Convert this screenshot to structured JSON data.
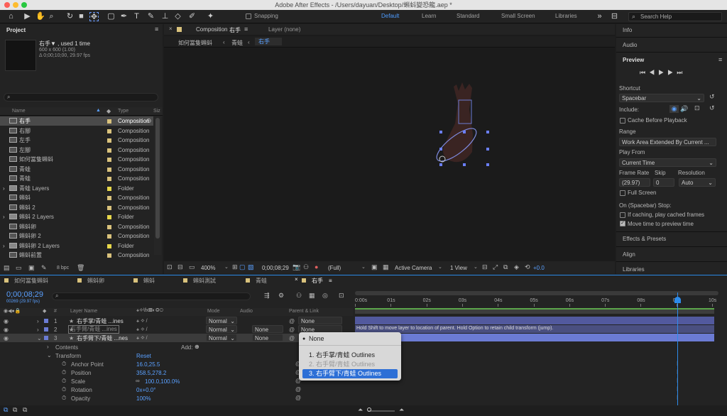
{
  "titlebar": {
    "title": "Adobe After Effects - /Users/dayuan/Desktop/蝌蚪變恐龍.aep *"
  },
  "toolbar": {
    "snapping": "Snapping",
    "workspaces": [
      "Default",
      "Learn",
      "Standard",
      "Small Screen",
      "Libraries"
    ],
    "search": "Search Help"
  },
  "project": {
    "tab": "Project",
    "item_name": "右手▼ , used 1 time",
    "item_size": "600 x 600 (1.00)",
    "item_dur": "Δ 0;00;10;00, 29.97 fps",
    "col_name": "Name",
    "col_type": "Type",
    "col_size": "Siz",
    "bpc": "8 bpc",
    "items": [
      {
        "name": "右手",
        "type": "Composition",
        "kind": "comp"
      },
      {
        "name": "右腳",
        "type": "Composition",
        "kind": "comp"
      },
      {
        "name": "左手",
        "type": "Composition",
        "kind": "comp"
      },
      {
        "name": "左腳",
        "type": "Composition",
        "kind": "comp"
      },
      {
        "name": "如何當隻蝌蚪",
        "type": "Composition",
        "kind": "comp"
      },
      {
        "name": "青蛙",
        "type": "Composition",
        "kind": "comp"
      },
      {
        "name": "青蛙",
        "type": "Composition",
        "kind": "comp"
      },
      {
        "name": "青蛙 Layers",
        "type": "Folder",
        "kind": "folder"
      },
      {
        "name": "蝌蚪",
        "type": "Composition",
        "kind": "comp"
      },
      {
        "name": "蝌蚪 2",
        "type": "Composition",
        "kind": "comp"
      },
      {
        "name": "蝌蚪 2 Layers",
        "type": "Folder",
        "kind": "folder"
      },
      {
        "name": "蝌蚪卵",
        "type": "Composition",
        "kind": "comp"
      },
      {
        "name": "蝌蚪卵 2",
        "type": "Composition",
        "kind": "comp"
      },
      {
        "name": "蝌蚪卵 2 Layers",
        "type": "Folder",
        "kind": "folder"
      },
      {
        "name": "蝌蚪前置",
        "type": "Composition",
        "kind": "comp"
      }
    ]
  },
  "comp": {
    "tab": "Composition",
    "tab_name": "右手",
    "layer_tab": "Layer (none)",
    "crumbs": [
      "如何當隻蝌蚪",
      "青蛙",
      "右手"
    ],
    "zoom": "400%",
    "time": "0;00;08;29",
    "res": "(Full)",
    "camera": "Active Camera",
    "view": "1 View",
    "exposure": "+0.0"
  },
  "right": {
    "info": "Info",
    "audio": "Audio",
    "preview": "Preview",
    "shortcut": "Shortcut",
    "shortcut_val": "Spacebar",
    "include": "Include:",
    "cache": "Cache Before Playback",
    "range": "Range",
    "range_val": "Work Area Extended By Current ...",
    "playfrom": "Play From",
    "playfrom_val": "Current Time",
    "framerate": "Frame Rate",
    "skip": "Skip",
    "resolution": "Resolution",
    "fr_val": "(29.97)",
    "skip_val": "0",
    "res_val": "Auto",
    "fullscreen": "Full Screen",
    "stop": "On (Spacebar) Stop:",
    "caching": "If caching, play cached frames",
    "movetime": "Move time to preview time",
    "effects": "Effects & Presets",
    "align": "Align",
    "libraries": "Libraries"
  },
  "timeline": {
    "tabs": [
      "如何當隻蝌蚪",
      "蝌蚪卵",
      "蝌蚪",
      "蝌蚪測試",
      "青蛙",
      "右手"
    ],
    "time": "0;00;08;29",
    "frames": "00269 (29.97 fps)",
    "col_layer": "Layer Name",
    "col_mode": "Mode",
    "col_parent": "Parent & Link",
    "col_audio": "Audio",
    "ticks": [
      "0:00s",
      "01s",
      "02s",
      "03s",
      "04s",
      "05s",
      "06s",
      "07s",
      "08s",
      "09s",
      "10s"
    ],
    "layers": [
      {
        "num": "1",
        "name": "右手掌/青蛙 ...ines",
        "mode": "Normal",
        "trk": "",
        "parent": "None"
      },
      {
        "num": "2",
        "name": "右手臂/青蛙 ...ines",
        "mode": "Normal",
        "trk": "None",
        "parent": "None"
      },
      {
        "num": "3",
        "name": "右手臂下/青蛙 ...nes",
        "mode": "Normal",
        "trk": "None",
        "parent": ""
      }
    ],
    "contents": "Contents",
    "add": "Add:",
    "transform": "Transform",
    "reset": "Reset",
    "props": [
      {
        "name": "Anchor Point",
        "value": "16.0,25.5"
      },
      {
        "name": "Position",
        "value": "358.5,278.2"
      },
      {
        "name": "Scale",
        "value": "100.0,100.0%"
      },
      {
        "name": "Rotation",
        "value": "0x+0.0°"
      },
      {
        "name": "Opacity",
        "value": "100%"
      }
    ],
    "tip": "Hold Shift to move layer to location of parent. Hold Option to retain child transform (jump).",
    "menu": [
      "None",
      "1. 右手掌/青蛙 Outlines",
      "2. 右手臂/青蛙 Outlines",
      "3. 右手臂下/青蛙 Outlines"
    ]
  },
  "colors": {
    "accent": "#2d8ceb",
    "label_comp": "#d9c27c",
    "label_folder": "#e8d84b",
    "layer_blue": "#6b7bd4"
  }
}
